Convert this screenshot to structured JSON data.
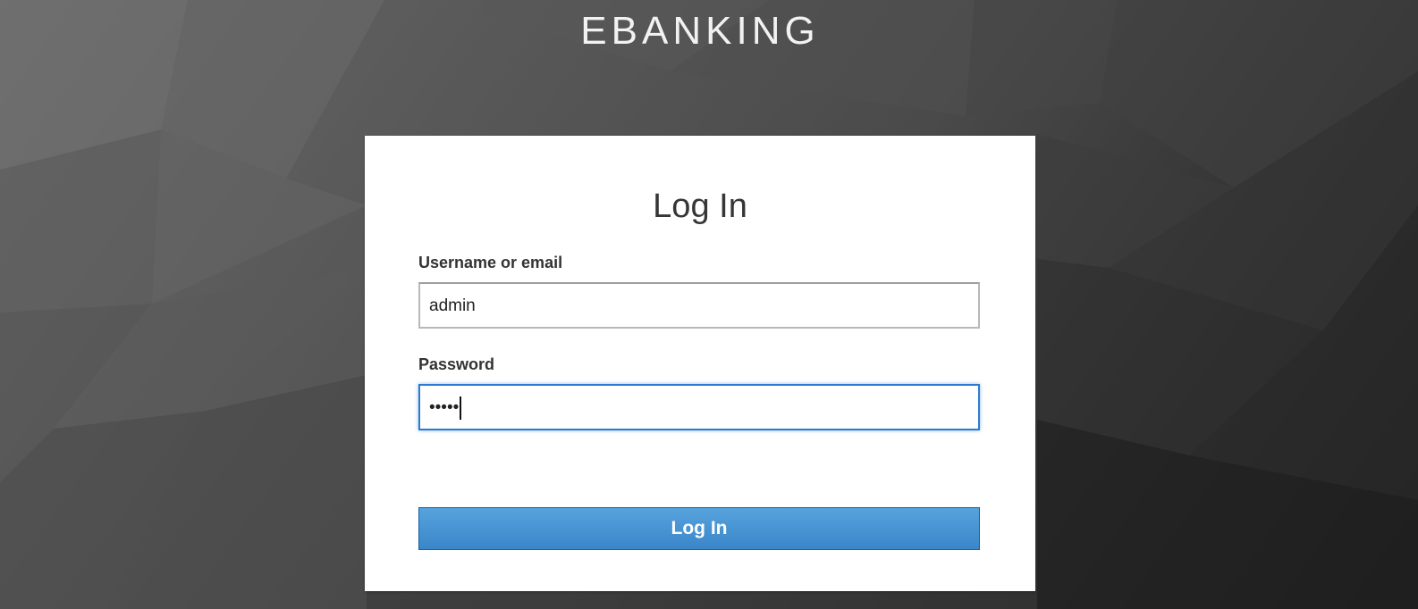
{
  "brand": {
    "title": "EBANKING"
  },
  "login": {
    "title": "Log In",
    "username_label": "Username or email",
    "username_value": "admin",
    "password_label": "Password",
    "password_value": "•••••",
    "submit_label": "Log In"
  },
  "colors": {
    "button": "#3a86c9",
    "focus_border": "#2a7bd1",
    "card": "#ffffff"
  }
}
